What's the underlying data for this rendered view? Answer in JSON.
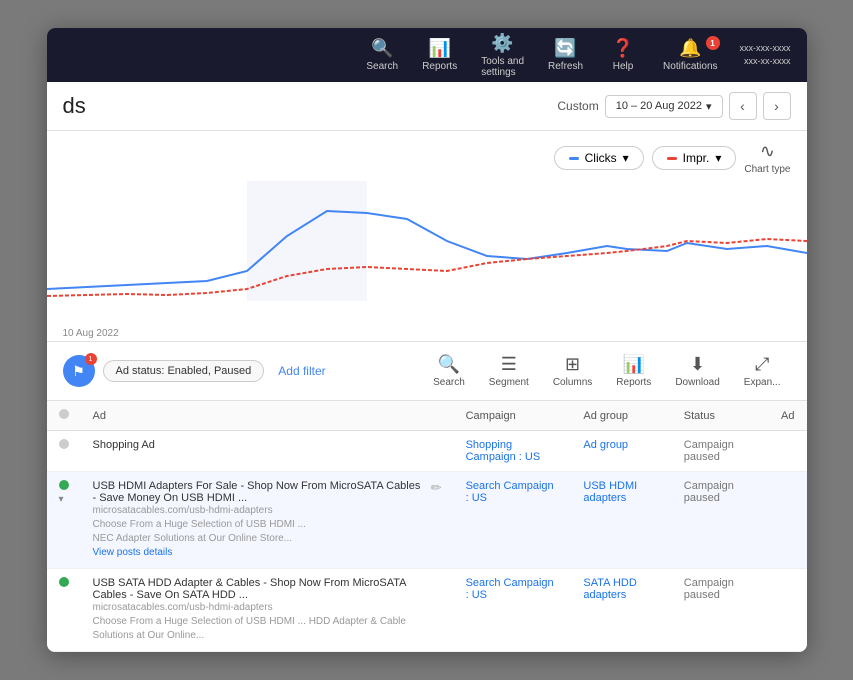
{
  "window": {
    "title": "Google Ads"
  },
  "topnav": {
    "items": [
      {
        "id": "search",
        "label": "Search",
        "icon": "🔍"
      },
      {
        "id": "reports",
        "label": "Reports",
        "icon": "📊"
      },
      {
        "id": "tools",
        "label": "Tools and\nsettings",
        "icon": "⚙️"
      },
      {
        "id": "refresh",
        "label": "Refresh",
        "icon": "🔄"
      },
      {
        "id": "help",
        "label": "Help",
        "icon": "❓"
      },
      {
        "id": "notifications",
        "label": "Notifications",
        "icon": "🔔",
        "badge": "1"
      }
    ],
    "account_line1": "xxx-xxx-xxxx",
    "account_line2": "xxx-xx-xxxx"
  },
  "titlebar": {
    "page_title": "ds",
    "date_label": "Custom",
    "date_range": "10 – 20 Aug 2022"
  },
  "chart": {
    "metrics": [
      {
        "id": "clicks",
        "label": "Clicks",
        "color": "#4285f4"
      },
      {
        "id": "impr",
        "label": "Impr.",
        "color": "#ea4335"
      }
    ],
    "chart_type_label": "Chart type",
    "date_label": "10 Aug 2022"
  },
  "toolbar": {
    "filter_badge": "1",
    "filter_tag": "Ad status: Enabled, Paused",
    "add_filter": "Add filter",
    "actions": [
      {
        "id": "search",
        "label": "Search",
        "icon": "🔍"
      },
      {
        "id": "segment",
        "label": "Segment",
        "icon": "☰"
      },
      {
        "id": "columns",
        "label": "Columns",
        "icon": "⊞"
      },
      {
        "id": "reports",
        "label": "Reports",
        "icon": "📊"
      },
      {
        "id": "download",
        "label": "Download",
        "icon": "⬇"
      },
      {
        "id": "expand",
        "label": "Expan...",
        "icon": "⤢"
      }
    ]
  },
  "table": {
    "columns": [
      "",
      "Ad",
      "Campaign",
      "Ad group",
      "Status",
      "Ad"
    ],
    "rows": [
      {
        "id": "row1",
        "dot_color": "gray",
        "ad_name": "Shopping Ad",
        "ad_detail": "",
        "campaign": "Shopping Campaign : US",
        "ad_group": "Ad group",
        "status": "Campaign paused",
        "extra": ""
      },
      {
        "id": "row2",
        "dot_color": "green",
        "ad_name": "USB HDMI Adapters For Sale - Shop Now From MicroSATA Cables - Save Money On USB HDMI ...",
        "ad_detail": "microsatacables.com/usb-hdmi-adapters\nChoose From a Huge Selection of USB HDMI ...\nNEC Adapter Solutions at Our Online Store...\nView posts details",
        "campaign": "Search Campaign : US",
        "ad_group": "USB HDMI adapters",
        "status": "Campaign paused",
        "extra": "",
        "has_edit": true
      },
      {
        "id": "row3",
        "dot_color": "green",
        "ad_name": "USB SATA HDD Adapter & Cables - Shop Now From MicroSATA Cables - Save On SATA HDD ...",
        "ad_detail": "microsatacables.com/usb-hdmi-adapters\nChoose From a Huge Selection of USB HDMI ... HDD Adapter & Cable Solutions at Our Online...",
        "campaign": "Search Campaign : US",
        "ad_group": "SATA HDD adapters",
        "status": "Campaign paused",
        "extra": ""
      }
    ]
  }
}
